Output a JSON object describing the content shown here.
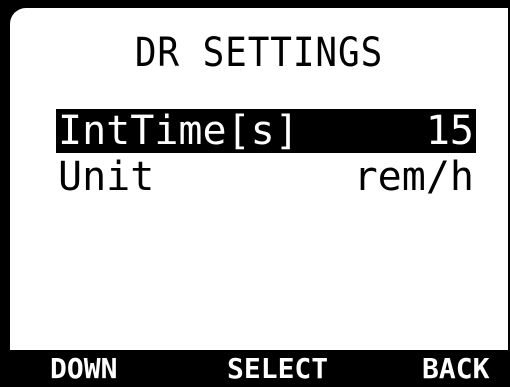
{
  "screen": {
    "title": "DR SETTINGS"
  },
  "menu": {
    "items": [
      {
        "label": "IntTime[s]",
        "value": "15",
        "selected": true
      },
      {
        "label": "Unit",
        "value": "rem/h",
        "selected": false
      }
    ]
  },
  "softkeys": {
    "left": "DOWN",
    "center": "SELECT",
    "right": "BACK"
  },
  "colors": {
    "lcd_background": "#ffffff",
    "lcd_foreground": "#000000",
    "bezel": "#000000"
  }
}
